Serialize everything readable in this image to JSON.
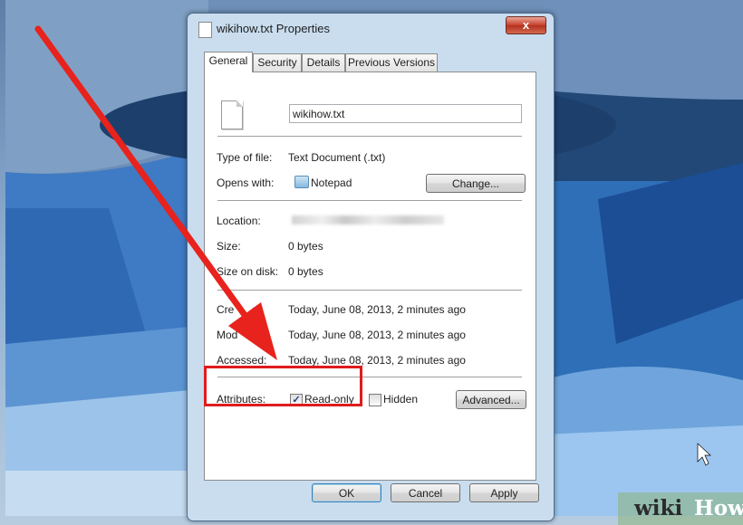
{
  "dialog": {
    "title": "wikihow.txt Properties",
    "close_label": "x"
  },
  "tabs": [
    {
      "label": "General",
      "active": true
    },
    {
      "label": "Security"
    },
    {
      "label": "Details"
    },
    {
      "label": "Previous Versions"
    }
  ],
  "general": {
    "file_name": "wikihow.txt",
    "type_label": "Type of file:",
    "type_value": "Text Document (.txt)",
    "opens_label": "Opens with:",
    "opens_value": "Notepad",
    "change_label": "Change...",
    "location_label": "Location:",
    "size_label": "Size:",
    "size_value": "0 bytes",
    "size_on_disk_label": "Size on disk:",
    "size_on_disk_value": "0 bytes",
    "created_label": "Cre",
    "created_label_tail": "d:",
    "created_value": "Today, June 08, 2013, 2 minutes ago",
    "modified_label": "Mod",
    "modified_value": "Today, June 08, 2013, 2 minutes ago",
    "accessed_label": "Accessed:",
    "accessed_value": "Today, June 08, 2013, 2 minutes ago",
    "attributes_label": "Attributes:",
    "readonly_label": "Read-only",
    "readonly_checked": true,
    "hidden_label": "Hidden",
    "hidden_checked": false,
    "advanced_label": "Advanced..."
  },
  "footer": {
    "ok_label": "OK",
    "cancel_label": "Cancel",
    "apply_label": "Apply"
  },
  "watermark": {
    "wiki": "wiki",
    "how": "How"
  },
  "colors": {
    "highlight": "#e01c1c",
    "arrow": "#e8221c"
  }
}
